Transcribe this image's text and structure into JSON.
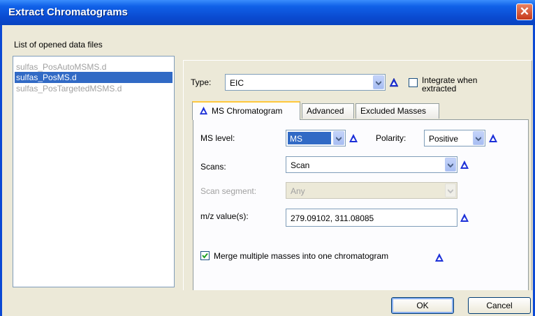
{
  "window": {
    "title": "Extract Chromatograms",
    "close_glyph": "✕"
  },
  "files": {
    "label": "List of opened data files",
    "items": [
      {
        "name": "sulfas_PosAutoMSMS.d",
        "selected": false
      },
      {
        "name": "sulfas_PosMS.d",
        "selected": true
      },
      {
        "name": "sulfas_PosTargetedMSMS.d",
        "selected": false
      }
    ]
  },
  "type": {
    "label": "Type:",
    "value": "EIC",
    "integrate_label_line1": "Integrate when",
    "integrate_label_line2": "extracted",
    "integrate_checked": false
  },
  "tabs": [
    {
      "label": "MS Chromatogram",
      "active": true,
      "icon": "blue-triangle-icon"
    },
    {
      "label": "Advanced",
      "active": false
    },
    {
      "label": "Excluded Masses",
      "active": false
    }
  ],
  "form": {
    "ms_level_label": "MS level:",
    "ms_level_value": "MS",
    "polarity_label": "Polarity:",
    "polarity_value": "Positive",
    "scans_label": "Scans:",
    "scans_value": "Scan",
    "scan_segment_label": "Scan segment:",
    "scan_segment_value": "Any",
    "mz_label": "m/z value(s):",
    "mz_value": "279.09102, 311.08085",
    "merge_label": "Merge multiple masses into one chromatogram",
    "merge_checked": true
  },
  "buttons": {
    "ok": "OK",
    "cancel": "Cancel"
  },
  "colors": {
    "title_bar": "#0a4ad0",
    "selection": "#316ac5",
    "triangle_icon": "#1b2fd8",
    "check": "#21a121"
  }
}
